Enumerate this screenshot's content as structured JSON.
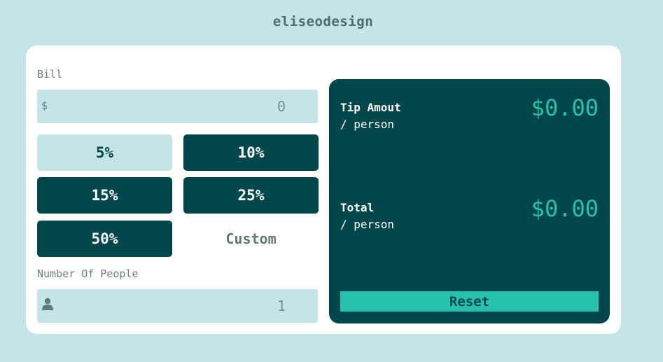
{
  "brand": "eliseodesign",
  "bill": {
    "label": "Bill",
    "prefix": "$",
    "value": "0"
  },
  "tip_options": [
    {
      "label": "5%",
      "selected": true
    },
    {
      "label": "10%",
      "selected": false
    },
    {
      "label": "15%",
      "selected": false
    },
    {
      "label": "25%",
      "selected": false
    },
    {
      "label": "50%",
      "selected": false
    }
  ],
  "custom_label": "Custom",
  "people": {
    "label": "Number Of People",
    "icon": "person-icon",
    "value": "1"
  },
  "results": {
    "tip": {
      "title": "Tip Amout",
      "sub": "/ person",
      "amount": "$0.00"
    },
    "total": {
      "title": "Total",
      "sub": "/ person",
      "amount": "$0.00"
    }
  },
  "reset_label": "Reset",
  "colors": {
    "background": "#c5e4e7",
    "dark": "#00474b",
    "accent": "#26c2ad"
  }
}
